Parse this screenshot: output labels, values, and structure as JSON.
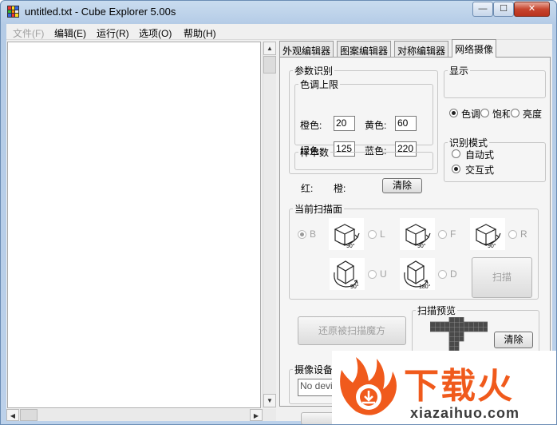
{
  "window": {
    "title": "untitled.txt - Cube Explorer 5.00s",
    "controls": {
      "minimize": "—",
      "maximize": "☐",
      "close": "✕"
    }
  },
  "menu": [
    "文件(F)",
    "编辑(E)",
    "运行(R)",
    "选项(O)",
    "帮助(H)"
  ],
  "tabs": [
    "外观编辑器",
    "图案编辑器",
    "对称编辑器",
    "网络摄像"
  ],
  "params": {
    "title": "参数识别",
    "hue_limit": {
      "title": "色调上限",
      "orange_label": "橙色:",
      "orange_value": "20",
      "yellow_label": "黄色:",
      "yellow_value": "60",
      "green_label": "绿色:",
      "green_value": "125",
      "blue_label": "蓝色:",
      "blue_value": "220"
    },
    "samples": {
      "title": "样本数",
      "red_label": "红:",
      "orange_label": "橙:",
      "clear_label": "清除"
    }
  },
  "display": {
    "title": "显示",
    "options": [
      "色调",
      "饱和",
      "亮度"
    ]
  },
  "mode": {
    "title": "识别模式",
    "options": [
      "自动式",
      "交互式"
    ]
  },
  "scan": {
    "title": "当前扫描面",
    "faces": [
      "B",
      "L",
      "F",
      "R",
      "U",
      "D"
    ],
    "angles": [
      "90°",
      "90°",
      "90°",
      "90°",
      "180°"
    ],
    "scan_button": "扫描"
  },
  "restore_button": "还原被扫描魔方",
  "preview": {
    "title": "扫描预览",
    "clear_label": "清除"
  },
  "device": {
    "title": "摄像设备",
    "value": "No device"
  },
  "watermark": {
    "name": "下载火",
    "url": "xiazaihuo.com"
  },
  "colors": {
    "accent_orange": "#f05a1c",
    "dark_grey": "#3a3a3a"
  }
}
